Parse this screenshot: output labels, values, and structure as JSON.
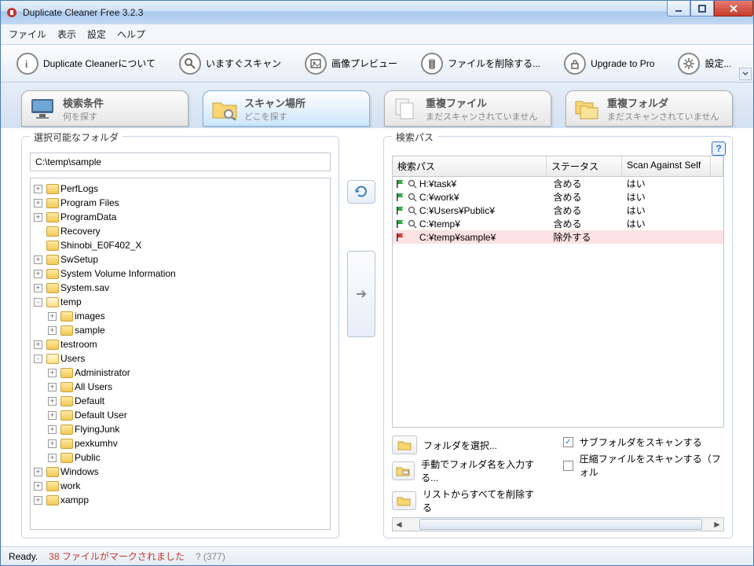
{
  "window": {
    "title": "Duplicate Cleaner Free 3.2.3"
  },
  "menu": {
    "file": "ファイル",
    "view": "表示",
    "settings": "設定",
    "help": "ヘルプ"
  },
  "toolbar": {
    "about": "Duplicate Cleanerについて",
    "scan_now": "いますぐスキャン",
    "preview": "画像プレビュー",
    "delete": "ファイルを削除する...",
    "upgrade": "Upgrade to Pro",
    "settings": "設定..."
  },
  "tabs": {
    "criteria": {
      "title": "検索条件",
      "sub": "何を探す"
    },
    "location": {
      "title": "スキャン場所",
      "sub": "どこを探す"
    },
    "dupfiles": {
      "title": "重複ファイル",
      "sub": "まだスキャンされていません"
    },
    "dupfolders": {
      "title": "重複フォルダ",
      "sub": "まだスキャンされていません"
    }
  },
  "left": {
    "legend": "選択可能なフォルダ",
    "path": "C:\\temp\\sample",
    "tree": [
      {
        "exp": "+",
        "name": "PerfLogs"
      },
      {
        "exp": "+",
        "name": "Program Files"
      },
      {
        "exp": "+",
        "name": "ProgramData"
      },
      {
        "exp": " ",
        "name": "Recovery"
      },
      {
        "exp": " ",
        "name": "Shinobi_E0F402_X"
      },
      {
        "exp": "+",
        "name": "SwSetup"
      },
      {
        "exp": "+",
        "name": "System Volume Information"
      },
      {
        "exp": "+",
        "name": "System.sav"
      },
      {
        "exp": "-",
        "name": "temp",
        "open": true,
        "children": [
          {
            "exp": "+",
            "name": "images"
          },
          {
            "exp": "+",
            "name": "sample"
          }
        ]
      },
      {
        "exp": "+",
        "name": "testroom"
      },
      {
        "exp": "-",
        "name": "Users",
        "open": true,
        "children": [
          {
            "exp": "+",
            "name": "Administrator"
          },
          {
            "exp": "+",
            "name": "All Users"
          },
          {
            "exp": "+",
            "name": "Default"
          },
          {
            "exp": "+",
            "name": "Default User"
          },
          {
            "exp": "+",
            "name": "FlyingJunk"
          },
          {
            "exp": "+",
            "name": "pexkumhv"
          },
          {
            "exp": "+",
            "name": "Public"
          }
        ]
      },
      {
        "exp": "+",
        "name": "Windows"
      },
      {
        "exp": "+",
        "name": "work"
      },
      {
        "exp": "+",
        "name": "xampp"
      }
    ]
  },
  "right": {
    "legend": "検索パス",
    "headers": {
      "path": "検索パス",
      "status": "ステータス",
      "self": "Scan Against Self"
    },
    "rows": [
      {
        "flag": "green",
        "path": "H:¥task¥",
        "status": "含める",
        "self": "はい"
      },
      {
        "flag": "green",
        "path": "C:¥work¥",
        "status": "含める",
        "self": "はい"
      },
      {
        "flag": "green",
        "path": "C:¥Users¥Public¥",
        "status": "含める",
        "self": "はい"
      },
      {
        "flag": "green",
        "path": "C:¥temp¥",
        "status": "含める",
        "self": "はい"
      },
      {
        "flag": "red",
        "path": "C:¥temp¥sample¥",
        "status": "除外する",
        "self": ""
      }
    ],
    "buttons": {
      "select_folder": "フォルダを選択...",
      "manual_input": "手動でフォルダ名を入力する...",
      "remove_all": "リストからすべてを削除する"
    },
    "checks": {
      "subfolders": "サブフォルダをスキャンする",
      "archives": "圧縮ファイルをスキャンする（フォル"
    }
  },
  "status": {
    "ready": "Ready.",
    "marked": "38 ファイルがマークされました",
    "q": "? (377)"
  }
}
